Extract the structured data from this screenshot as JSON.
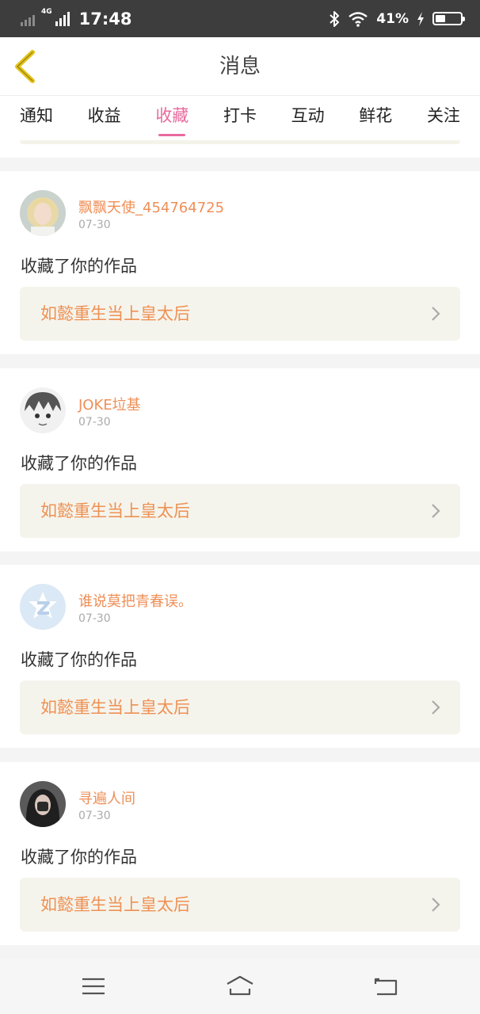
{
  "status_bar": {
    "network": "4G",
    "time": "17:48",
    "battery_text": "41%",
    "battery_level": 0.41,
    "icons": [
      "signal-icon",
      "bluetooth-icon",
      "wifi-icon",
      "charging-icon",
      "battery-icon"
    ]
  },
  "header": {
    "title": "消息",
    "back_icon": "chevron-left-icon",
    "accent_color": "#e3c31a"
  },
  "tabs": [
    {
      "label": "通知",
      "active": false
    },
    {
      "label": "收益",
      "active": false
    },
    {
      "label": "收藏",
      "active": true
    },
    {
      "label": "打卡",
      "active": false
    },
    {
      "label": "互动",
      "active": false
    },
    {
      "label": "鲜花",
      "active": false
    },
    {
      "label": "关注",
      "active": false
    }
  ],
  "colors": {
    "active_tab": "#e96a9e",
    "username": "#ef8f57",
    "work_title": "#ee9154",
    "work_bg": "#f5f4ec"
  },
  "messages": [
    {
      "username": "飘飘天使_454764725",
      "date": "07-30",
      "action": "收藏了你的作品",
      "work_title": "如懿重生当上皇太后",
      "avatar": "blonde-woman-avatar"
    },
    {
      "username": "JOKE垃基",
      "date": "07-30",
      "action": "收藏了你的作品",
      "work_title": "如懿重生当上皇太后",
      "avatar": "anime-boy-avatar"
    },
    {
      "username": "谁说莫把青春误。",
      "date": "07-30",
      "action": "收藏了你的作品",
      "work_title": "如懿重生当上皇太后",
      "avatar": "qq-default-avatar"
    },
    {
      "username": "寻遍人间",
      "date": "07-30",
      "action": "收藏了你的作品",
      "work_title": "如懿重生当上皇太后",
      "avatar": "girl-photo-avatar"
    }
  ],
  "nav": {
    "icons": [
      "menu-icon",
      "home-icon",
      "back-icon"
    ]
  }
}
